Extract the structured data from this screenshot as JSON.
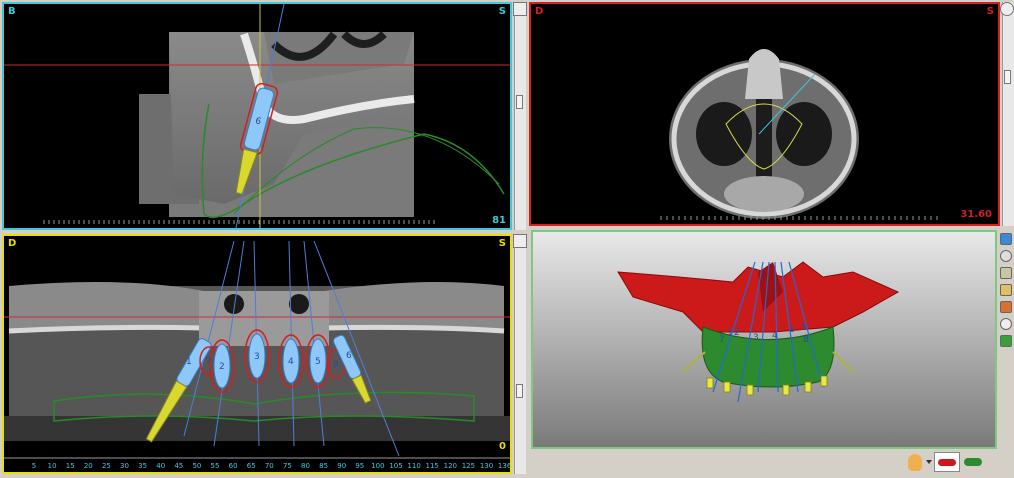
{
  "views": {
    "sagittal": {
      "label_left": "B",
      "label_right": "S",
      "value": "81"
    },
    "axial": {
      "label_left": "D",
      "label_right": "S",
      "value": "31.60"
    },
    "panoramic": {
      "label_left": "D",
      "label_right": "S",
      "value": "0"
    },
    "model": {}
  },
  "implants": {
    "sagittal": "6",
    "panoramic": [
      "1",
      "7",
      "2",
      "3",
      "4",
      "5",
      "8",
      "6"
    ],
    "model": [
      "7",
      "1",
      "2",
      "3",
      "4",
      "6",
      "5",
      "8"
    ]
  },
  "ruler": [
    "5",
    "10",
    "15",
    "20",
    "25",
    "30",
    "35",
    "40",
    "45",
    "50",
    "55",
    "60",
    "65",
    "70",
    "75",
    "80",
    "85",
    "90",
    "95",
    "100",
    "105",
    "110",
    "115",
    "120",
    "125",
    "130",
    "136"
  ],
  "icons": [
    "skull-icon",
    "red-maxilla-model-icon",
    "green-model-icon"
  ],
  "colors": {
    "sagittal_border": "#3ec8d8",
    "axial_border": "#d42020",
    "panoramic_border": "#e8e000",
    "model_border": "#7fc87f"
  }
}
